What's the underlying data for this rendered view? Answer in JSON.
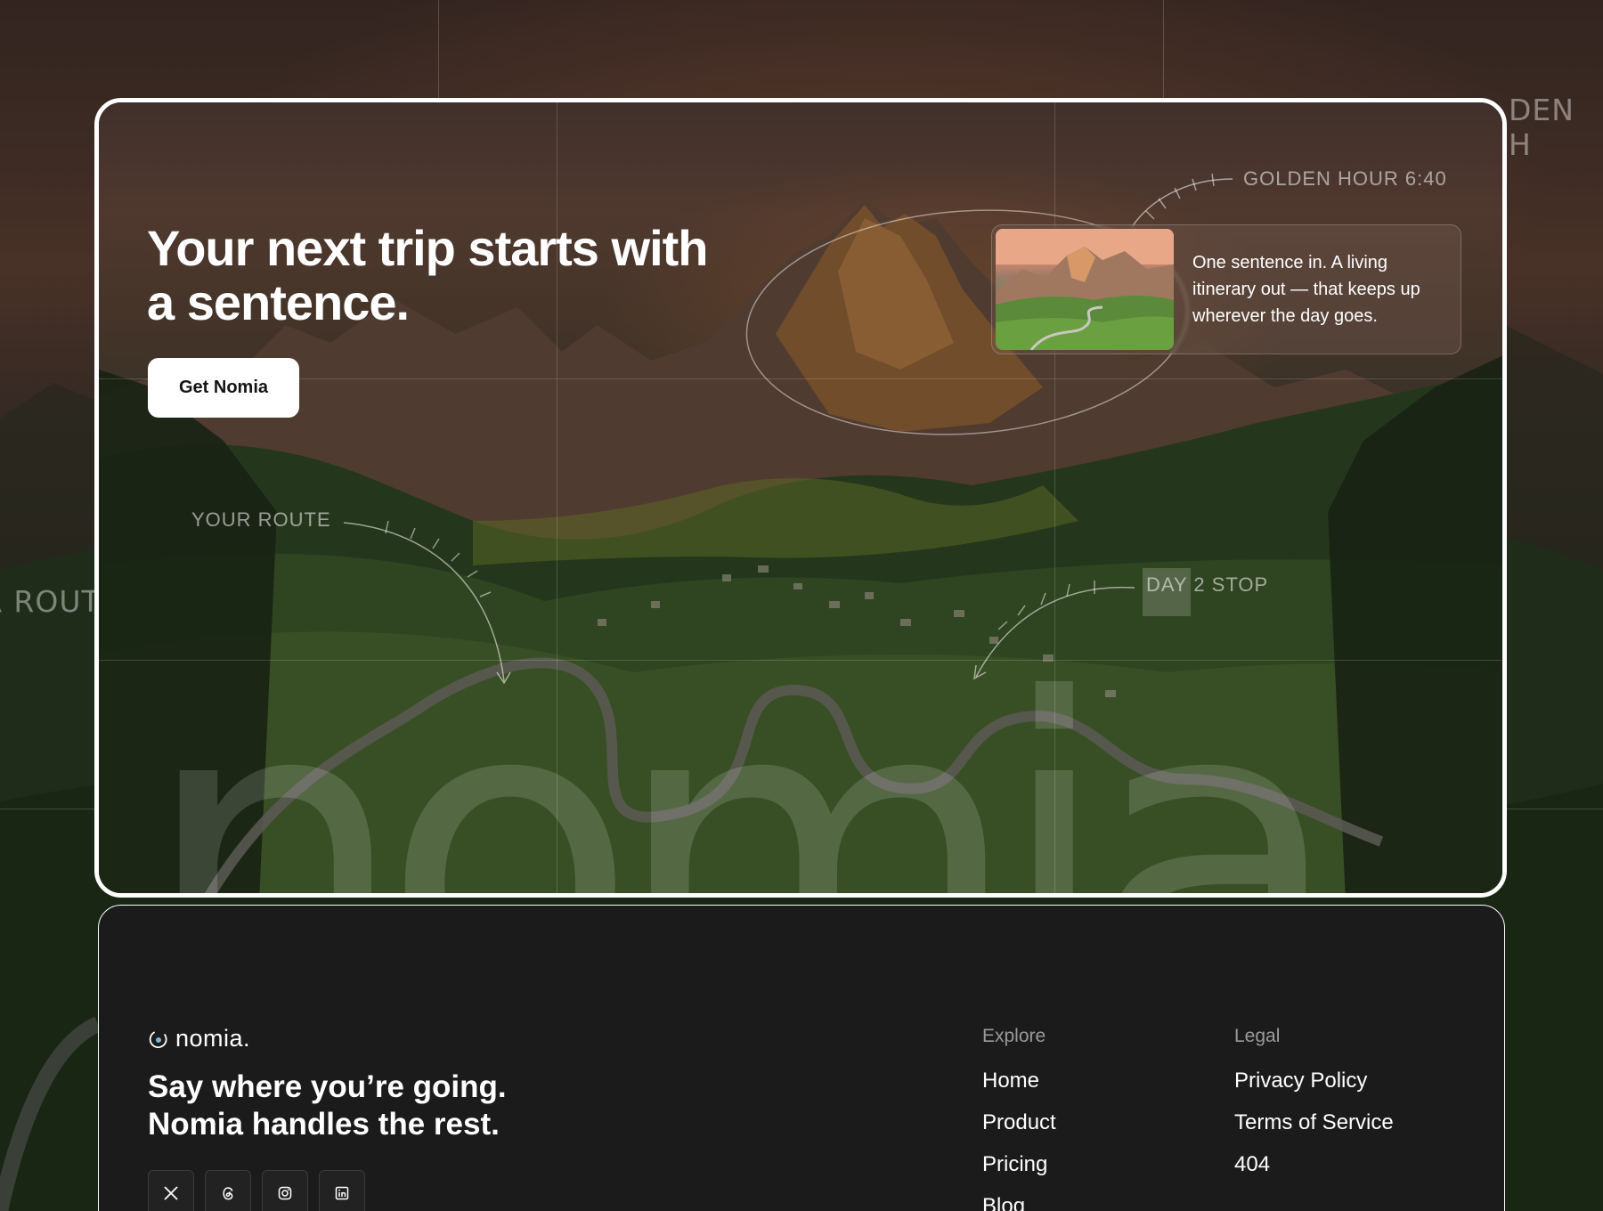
{
  "background": {
    "annotation_left": "R ROUT",
    "annotation_right": "DEN H"
  },
  "hero": {
    "title": "Your next trip starts with a sentence.",
    "cta_label": "Get Nomia",
    "watermark": "nomia",
    "annotations": {
      "route": "YOUR ROUTE",
      "golden_hour": "GOLDEN HOUR 6:40",
      "day_stop": "DAY 2 STOP"
    },
    "info_card": {
      "text": "One sentence in. A living itinerary out — that keeps up wherever the day goes."
    }
  },
  "footer": {
    "logo_text": "nomia.",
    "tagline": "Say where you’re going. Nomia handles the rest.",
    "social": [
      {
        "icon": "x-icon",
        "label": "X"
      },
      {
        "icon": "threads-icon",
        "label": "Threads"
      },
      {
        "icon": "instagram-icon",
        "label": "Instagram"
      },
      {
        "icon": "linkedin-icon",
        "label": "LinkedIn"
      }
    ],
    "explore": {
      "heading": "Explore",
      "links": [
        "Home",
        "Product",
        "Pricing",
        "Blog"
      ]
    },
    "legal": {
      "heading": "Legal",
      "links": [
        "Privacy Policy",
        "Terms of Service",
        "404"
      ]
    }
  },
  "colors": {
    "card_border": "#ffffff",
    "footer_bg": "#1b1b1b",
    "cta_bg": "#ffffff",
    "muted_text": "#9a9a9a"
  }
}
